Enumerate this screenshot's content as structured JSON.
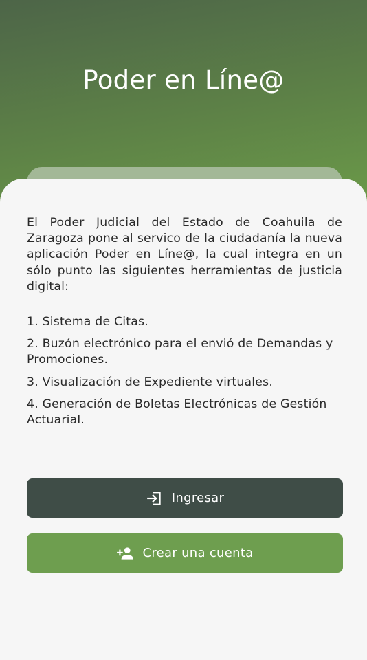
{
  "header": {
    "title": "Poder en Líne@"
  },
  "intro": {
    "text": "El Poder Judicial del Estado de Coahuila de Zaragoza pone al servico de la ciudadanía la nueva aplicación Poder en Líne@, la cual integra en un sólo punto las siguientes herramientas de justicia digital:"
  },
  "features": [
    "1. Sistema de Citas.",
    "2. Buzón electrónico para el envió de Demandas y Promociones.",
    "3. Visualización de Expediente virtuales.",
    "4. Generación de Boletas Electrónicas de Gestión Actuarial."
  ],
  "actions": {
    "login": {
      "label": "Ingresar",
      "icon": "login-icon"
    },
    "create": {
      "label": "Crear una cuenta",
      "icon": "person-add-icon"
    }
  },
  "colors": {
    "header_start": "#4d6548",
    "header_end": "#6b9a48",
    "login_button": "#3f4d47",
    "create_button": "#6e9e4f",
    "background": "#f6f6f6"
  }
}
